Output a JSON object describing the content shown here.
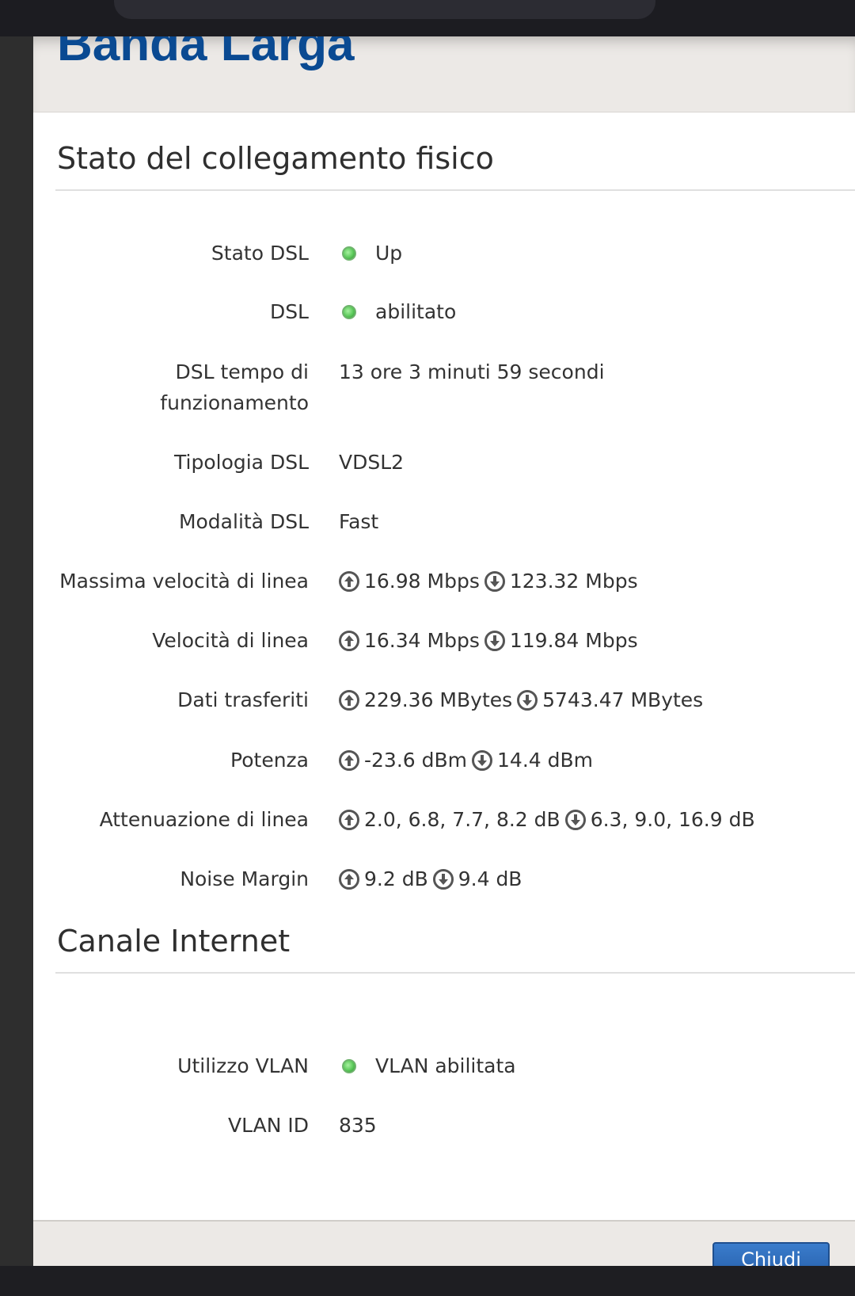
{
  "modal": {
    "title": "Banda Larga",
    "close_button_label": "Chiudi"
  },
  "section_physical": {
    "title": "Stato del collegamento fisico",
    "rows": [
      {
        "label": "Stato DSL",
        "status": "green",
        "value": "Up"
      },
      {
        "label": "DSL",
        "status": "green",
        "value": "abilitato"
      },
      {
        "label_line1": "DSL tempo di",
        "label_line2": "funzionamento",
        "value": "13 ore 3 minuti 59 secondi"
      },
      {
        "label": "Tipologia DSL",
        "value": "VDSL2"
      },
      {
        "label": "Modalità DSL",
        "value": "Fast"
      },
      {
        "label": "Massima velocità di linea",
        "up": "16.98 Mbps",
        "down": "123.32 Mbps"
      },
      {
        "label": "Velocità di linea",
        "up": "16.34 Mbps",
        "down": "119.84 Mbps"
      },
      {
        "label": "Dati trasferiti",
        "up": "229.36 MBytes",
        "down": "5743.47 MBytes"
      },
      {
        "label": "Potenza",
        "up": "-23.6 dBm",
        "down": "14.4 dBm"
      },
      {
        "label": "Attenuazione di linea",
        "up": "2.0, 6.8, 7.7, 8.2 dB",
        "down": "6.3, 9.0, 16.9 dB"
      },
      {
        "label": "Noise Margin",
        "up": "9.2 dB",
        "down": "9.4 dB"
      }
    ]
  },
  "section_internet": {
    "title": "Canale Internet",
    "rows": [
      {
        "label": "Utilizzo VLAN",
        "status": "green",
        "value": "VLAN abilitata"
      },
      {
        "label": "VLAN ID",
        "value": "835"
      }
    ]
  },
  "icons": {
    "status_led": "green-status-led-icon",
    "upload": "upload-arrow-icon",
    "download": "download-arrow-icon"
  },
  "colors": {
    "title_blue": "#0a4a92",
    "status_green": "#5bc95a",
    "header_bg": "#ece9e6",
    "button_blue": "#2a64b0"
  }
}
